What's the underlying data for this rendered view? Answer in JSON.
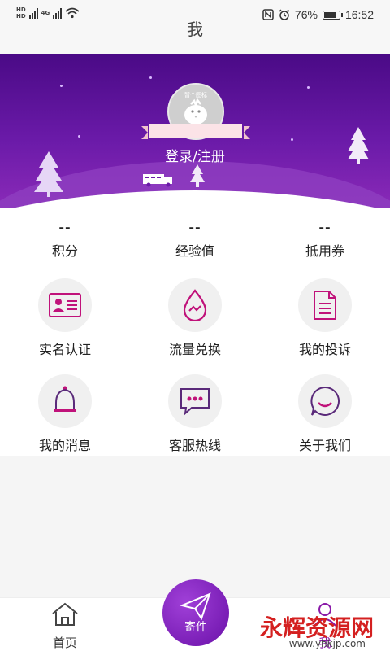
{
  "status_bar": {
    "network_left": "HD",
    "network_type": "4G",
    "battery": "76%",
    "time": "16:52"
  },
  "nav": {
    "title": "我"
  },
  "profile": {
    "avatar_caption": "暂个图标",
    "login_text": "登录/注册"
  },
  "stats": [
    {
      "value": "--",
      "label": "积分"
    },
    {
      "value": "--",
      "label": "经验值"
    },
    {
      "value": "--",
      "label": "抵用券"
    }
  ],
  "menu": [
    {
      "label": "实名认证",
      "icon": "id-card-icon"
    },
    {
      "label": "流量兑换",
      "icon": "data-drop-icon"
    },
    {
      "label": "我的投诉",
      "icon": "document-icon"
    },
    {
      "label": "我的消息",
      "icon": "bell-icon"
    },
    {
      "label": "客服热线",
      "icon": "chat-bubble-icon"
    },
    {
      "label": "关于我们",
      "icon": "smile-icon"
    }
  ],
  "tabs": {
    "home": "首页",
    "center": "寄件",
    "me": "我"
  },
  "watermark": {
    "text": "永辉资源网",
    "url": "www.yhkjp.com"
  },
  "colors": {
    "accent": "#8a1aa8",
    "header_top": "#4a0a86",
    "icon_magenta": "#c0127a"
  }
}
